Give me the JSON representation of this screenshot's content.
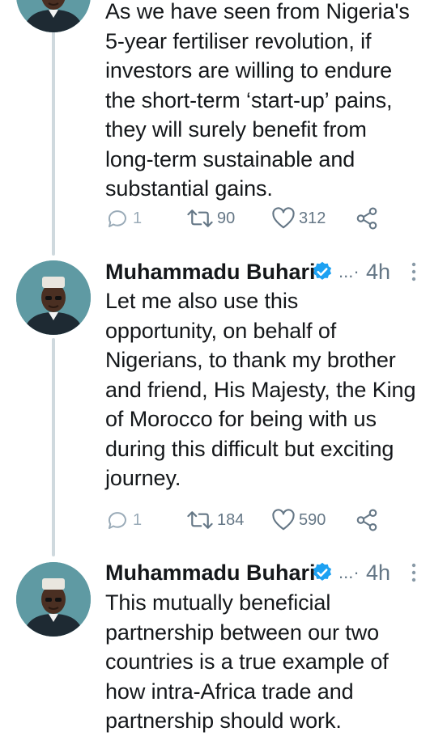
{
  "accent": "#1da1f2",
  "tweets": [
    {
      "author": "",
      "text": "As we have seen from Nigeria's\n5-year fertiliser revolution, if\ninvestors are willing to endure\nthe short-term ‘start-up’ pains,\nthey will surely benefit from\nlong-term sustainable and\nsubstantial gains.",
      "replies": "1",
      "retweets": "90",
      "likes": "312"
    },
    {
      "author": "Muhammadu Buhari",
      "handle_truncated": "...·",
      "time": "4h",
      "text": "Let me also use this\nopportunity, on behalf of\nNigerians, to thank my brother\nand friend, His Majesty, the King\nof Morocco for being with us\nduring this difficult but exciting\njourney.",
      "replies": "1",
      "retweets": "184",
      "likes": "590"
    },
    {
      "author": "Muhammadu Buhari",
      "handle_truncated": "...·",
      "time": "4h",
      "text": "This mutually beneficial\npartnership between our two\ncountries is a true example of\nhow intra-Africa trade and\npartnership should work."
    }
  ]
}
